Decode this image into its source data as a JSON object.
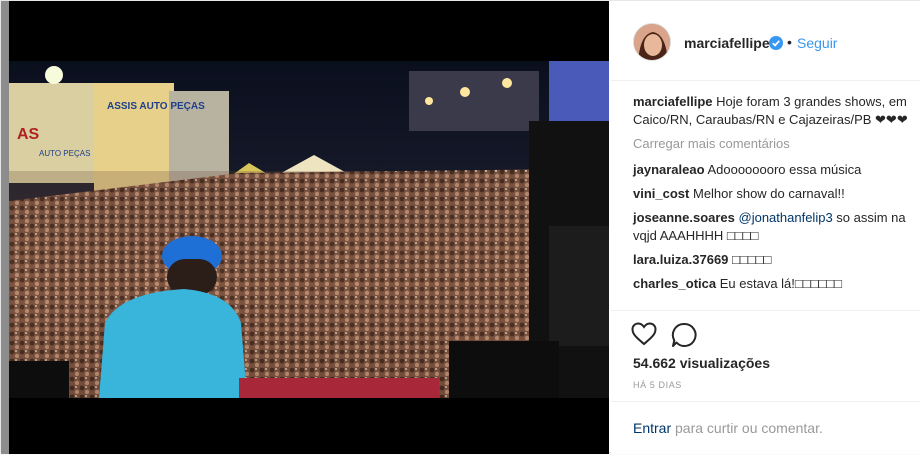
{
  "post": {
    "username": "marciafellipe",
    "follow_label": "Seguir",
    "dot": "•",
    "caption": "Hoje foram 3 grandes shows, em Caico/RN, Caraubas/RN e Cajazeiras/PB ❤❤❤"
  },
  "photo_signs": {
    "sign_left": "AS",
    "sign_store": "ASSIS AUTO PEÇAS",
    "sign_store_small": "AUTO PEÇAS"
  },
  "comments": {
    "load_more": "Carregar mais comentários",
    "items": [
      {
        "user": "jaynaraleao",
        "text": "Adoooooooro essa música"
      },
      {
        "user": "vini_cost",
        "text": "Melhor show do carnaval!!"
      },
      {
        "user": "joseanne.soares",
        "mention": "@jonathanfelip3",
        "text": " so assim na vqjd AAAHHHH □□□□"
      },
      {
        "user": "lara.luiza.37669",
        "text": "□□□□□"
      },
      {
        "user": "charles_otica",
        "text": "Eu estava lá!□□□□□□"
      }
    ]
  },
  "stats": {
    "views": "54.662 visualizações",
    "date": "HÁ 5 DIAS"
  },
  "footer": {
    "login_link": "Entrar",
    "login_text": " para curtir ou comentar."
  },
  "icons": {
    "heart": "heart-icon",
    "comment": "comment-icon",
    "verified": "verified-badge-icon"
  },
  "colors": {
    "link_blue": "#3897f0",
    "dark_link": "#003569",
    "text": "#262626",
    "muted": "#999999"
  }
}
